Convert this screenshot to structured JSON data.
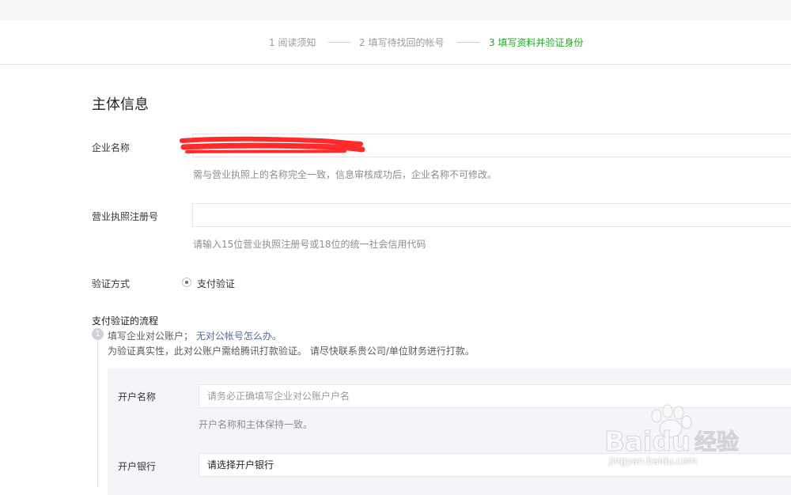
{
  "steps": [
    {
      "label": "1 阅读须知",
      "active": false
    },
    {
      "label": "2 填写待找回的帐号",
      "active": false
    },
    {
      "label": "3 填写资料并验证身份",
      "active": true
    }
  ],
  "section_title": "主体信息",
  "company": {
    "label": "企业名称",
    "hint": "需与营业执照上的名称完全一致，信息审核成功后，企业名称不可修改。"
  },
  "license": {
    "label": "营业执照注册号",
    "placeholder": "",
    "hint": "请输入15位营业执照注册号或18位的统一社会信用代码"
  },
  "verify": {
    "label": "验证方式",
    "option": "支付验证"
  },
  "flow": {
    "title": "支付验证的流程",
    "step1_text": "填写企业对公账户；",
    "step1_link": "无对公帐号怎么办。",
    "step1_desc": "为验证真实性，此对公账户需给腾讯打款验证。 请尽快联系贵公司/单位财务进行打款。"
  },
  "bank_form": {
    "account_name_label": "开户名称",
    "account_name_placeholder": "请务必正确填写企业对公账户户名",
    "account_name_hint": "开户名称和主体保持一致。",
    "bank_label": "开户银行",
    "bank_select": "请选择开户银行"
  },
  "watermark": {
    "brand": "Baidu",
    "brand_cn": "经验",
    "url": "jingyan.baidu.com"
  },
  "colors": {
    "active_step": "#1aad19",
    "link": "#576b95",
    "redaction": "#ff2a2a"
  }
}
